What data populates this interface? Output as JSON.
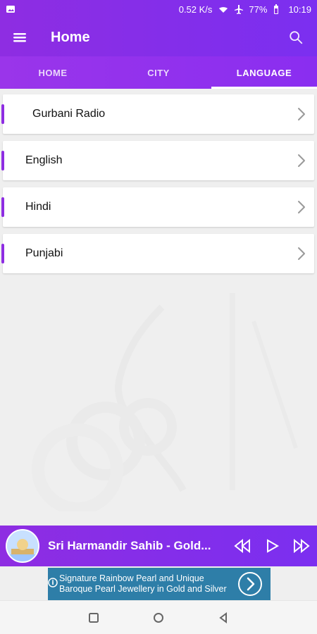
{
  "status_bar": {
    "speed": "0.52 K/s",
    "battery": "77%",
    "time": "10:19",
    "icons": [
      "gallery-icon",
      "wifi-icon",
      "airplane-icon",
      "battery-icon"
    ]
  },
  "app_bar": {
    "title": "Home",
    "menu_icon": "menu-icon",
    "search_icon": "search-icon"
  },
  "tabs": [
    {
      "label": "HOME"
    },
    {
      "label": "CITY"
    },
    {
      "label": "LANGUAGE"
    }
  ],
  "active_tab_index": 2,
  "list_items": [
    {
      "label": "Gurbani Radio"
    },
    {
      "label": "English"
    },
    {
      "label": "Hindi"
    },
    {
      "label": "Punjabi"
    }
  ],
  "player": {
    "now_playing": "Sri Harmandir Sahib - Gold..."
  },
  "ad": {
    "line1": "Signature Rainbow Pearl and Unique",
    "line2": "Baroque Pearl Jewellery in Gold and Silver"
  },
  "colors": {
    "accent": "#8e2de2",
    "ad": "#2e7ea8"
  }
}
